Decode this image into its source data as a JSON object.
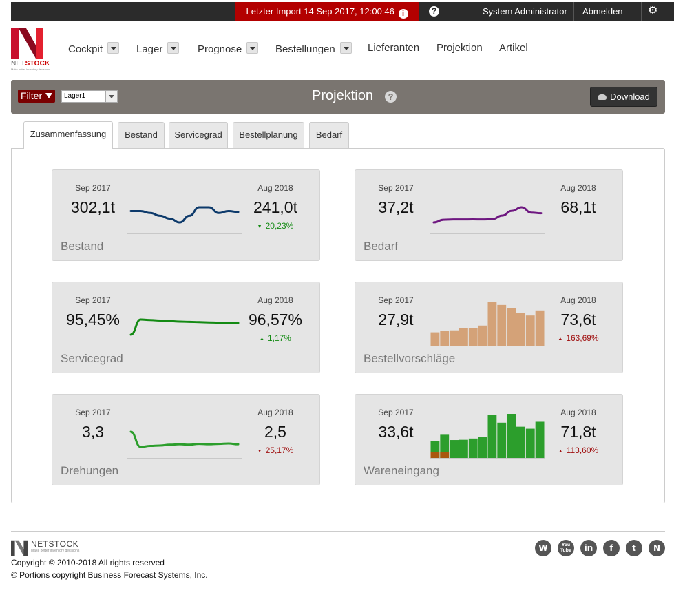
{
  "topbar": {
    "import_text": "Letzter Import 14 Sep 2017, 12:00:46",
    "help_glyph": "?",
    "user": "System Administrator",
    "logout": "Abmelden"
  },
  "logo": {
    "brand_a": "NET",
    "brand_b": "STOCK",
    "tagline": "Make better inventory decisions"
  },
  "nav": [
    {
      "label": "Cockpit",
      "dropdown": true
    },
    {
      "label": "Lager",
      "dropdown": true
    },
    {
      "label": "Prognose",
      "dropdown": true
    },
    {
      "label": "Bestellungen",
      "dropdown": true
    },
    {
      "label": "Lieferanten",
      "dropdown": false
    },
    {
      "label": "Projektion",
      "dropdown": false
    },
    {
      "label": "Artikel",
      "dropdown": false
    }
  ],
  "titlebar": {
    "filter_label": "Filter",
    "warehouse_value": "Lager1",
    "title": "Projektion",
    "help_glyph": "?",
    "download_label": "Download"
  },
  "tabs": [
    "Zusammenfassung",
    "Bestand",
    "Servicegrad",
    "Bestellplanung",
    "Bedarf"
  ],
  "active_tab": "Zusammenfassung",
  "cards": [
    {
      "name": "Bestand",
      "start_date": "Sep 2017",
      "start_value": "302,1t",
      "end_date": "Aug 2018",
      "end_value": "241,0t",
      "delta": "20,23%",
      "delta_dir": "down",
      "delta_color": "#138a13",
      "chart": {
        "type": "line",
        "color": "#0d3a6b",
        "values": [
          302,
          302,
          300,
          297,
          294,
          290,
          297,
          306,
          306,
          300,
          302,
          301
        ]
      }
    },
    {
      "name": "Bedarf",
      "start_date": "Sep 2017",
      "start_value": "37,2t",
      "end_date": "Aug 2018",
      "end_value": "68,1t",
      "delta": "",
      "delta_dir": "",
      "delta_color": "#a01010",
      "chart": {
        "type": "line",
        "color": "#6e1780",
        "values": [
          37,
          46,
          47,
          47,
          47.5,
          47,
          48,
          60,
          76,
          88,
          70,
          68
        ]
      }
    },
    {
      "name": "Servicegrad",
      "start_date": "Sep 2017",
      "start_value": "95,45%",
      "end_date": "Aug 2018",
      "end_value": "96,57%",
      "delta": "1,17%",
      "delta_dir": "up",
      "delta_color": "#138a13",
      "chart": {
        "type": "line",
        "color": "#138a13",
        "values": [
          95.45,
          96.9,
          96.85,
          96.8,
          96.75,
          96.7,
          96.68,
          96.65,
          96.62,
          96.6,
          96.58,
          96.57
        ]
      }
    },
    {
      "name": "Bestellvorschläge",
      "start_date": "Sep 2017",
      "start_value": "27,9t",
      "end_date": "Aug 2018",
      "end_value": "73,6t",
      "delta": "163,69%",
      "delta_dir": "up",
      "delta_color": "#a01010",
      "chart": {
        "type": "bar",
        "colors": [
          "#d4a278"
        ],
        "values": [
          27.9,
          30.5,
          32,
          36,
          36,
          42,
          92,
          85,
          79,
          68,
          63,
          73.6
        ]
      }
    },
    {
      "name": "Drehungen",
      "start_date": "Sep 2017",
      "start_value": "3,3",
      "end_date": "Aug 2018",
      "end_value": "2,5",
      "delta": "25,17%",
      "delta_dir": "down",
      "delta_color": "#a01010",
      "chart": {
        "type": "line",
        "color": "#2c9e2c",
        "values": [
          3.3,
          2.55,
          2.6,
          2.62,
          2.66,
          2.68,
          2.66,
          2.7,
          2.68,
          2.7,
          2.72,
          2.68
        ]
      }
    },
    {
      "name": "Wareneingang",
      "start_date": "Sep 2017",
      "start_value": "33,6t",
      "end_date": "Aug 2018",
      "end_value": "71,8t",
      "delta": "113,60%",
      "delta_dir": "up",
      "delta_color": "#a01010",
      "chart": {
        "type": "bar",
        "colors": [
          "#2c9e2c",
          "#a9570f"
        ],
        "values": [
          33.6,
          46,
          35.5,
          36,
          38.5,
          41,
          86,
          70,
          87.5,
          62,
          58,
          71.8
        ],
        "secondary_values": [
          12,
          12
        ]
      }
    }
  ],
  "footer": {
    "brand": "NETSTOCK",
    "tagline": "Make better inventory decisions",
    "copyright": "Copyright © 2010-2018 All rights reserved",
    "portions": "© Portions copyright Business Forecast Systems, Inc.",
    "social": [
      "W",
      "You Tube",
      "in",
      "f",
      "t",
      "N"
    ]
  }
}
